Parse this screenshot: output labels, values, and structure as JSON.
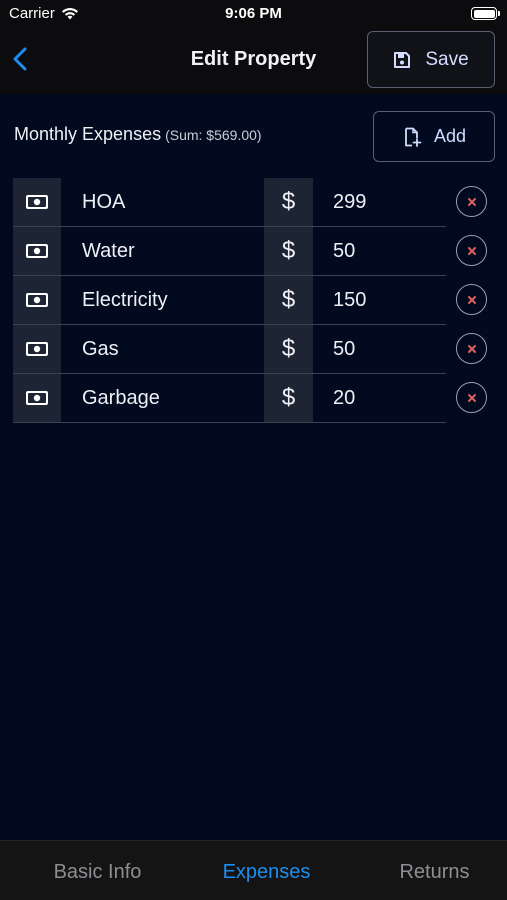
{
  "status_bar": {
    "carrier": "Carrier",
    "time": "9:06 PM",
    "wifi_icon": "wifi-icon",
    "battery_icon": "battery-icon"
  },
  "nav": {
    "back_icon": "chevron-left-icon",
    "title": "Edit Property",
    "save_label": "Save",
    "save_icon": "floppy-disk-icon"
  },
  "expenses": {
    "title": "Monthly Expenses",
    "sum_text": "(Sum: $569.00)",
    "add_label": "Add",
    "add_icon": "document-plus-icon",
    "currency_symbol": "$",
    "items": [
      {
        "name": "HOA",
        "amount": "299"
      },
      {
        "name": "Water",
        "amount": "50"
      },
      {
        "name": "Electricity",
        "amount": "150"
      },
      {
        "name": "Gas",
        "amount": "50"
      },
      {
        "name": "Garbage",
        "amount": "20"
      }
    ]
  },
  "tabs": [
    {
      "label": "Basic Info",
      "active": false
    },
    {
      "label": "Expenses",
      "active": true
    },
    {
      "label": "Returns",
      "active": false
    }
  ],
  "colors": {
    "accent": "#1e8df0",
    "background": "#020a1f",
    "remove_x": "#e06060"
  }
}
